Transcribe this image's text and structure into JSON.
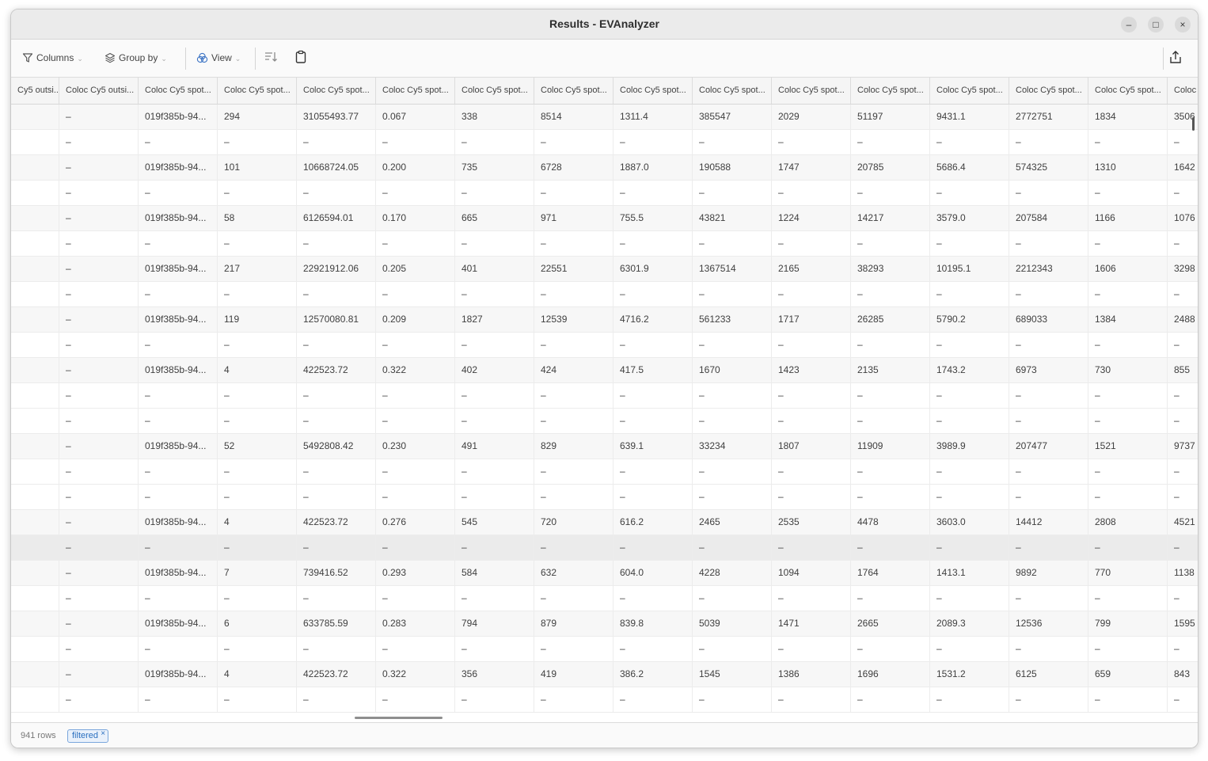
{
  "window": {
    "title": "Results - EVAnalyzer",
    "minimize_glyph": "–",
    "maximize_glyph": "□",
    "close_glyph": "×"
  },
  "toolbar": {
    "columns_label": "Columns",
    "group_by_label": "Group by",
    "view_label": "View",
    "columns_icon": "filter-icon",
    "group_by_icon": "layers-icon",
    "view_icon": "venn-icon",
    "sort_icon": "sort-icon",
    "clipboard_icon": "clipboard-icon",
    "export_icon": "share-icon"
  },
  "table": {
    "headers": [
      "Cy5 outsi...",
      "Coloc Cy5 outsi...",
      "Coloc Cy5 spot...",
      "Coloc Cy5 spot...",
      "Coloc Cy5 spot...",
      "Coloc Cy5 spot...",
      "Coloc Cy5 spot...",
      "Coloc Cy5 spot...",
      "Coloc Cy5 spot...",
      "Coloc Cy5 spot...",
      "Coloc Cy5 spot...",
      "Coloc Cy5 spot...",
      "Coloc Cy5 spot...",
      "Coloc Cy5 spot...",
      "Coloc Cy5 spot...",
      "Coloc"
    ],
    "rows": [
      [
        "",
        "–",
        "019f385b-94...",
        "294",
        "31055493.77",
        "0.067",
        "338",
        "8514",
        "1311.4",
        "385547",
        "2029",
        "51197",
        "9431.1",
        "2772751",
        "1834",
        "3506"
      ],
      [
        "",
        "–",
        "–",
        "–",
        "–",
        "–",
        "–",
        "–",
        "–",
        "–",
        "–",
        "–",
        "–",
        "–",
        "–",
        "–"
      ],
      [
        "",
        "–",
        "019f385b-94...",
        "101",
        "10668724.05",
        "0.200",
        "735",
        "6728",
        "1887.0",
        "190588",
        "1747",
        "20785",
        "5686.4",
        "574325",
        "1310",
        "1642"
      ],
      [
        "",
        "–",
        "–",
        "–",
        "–",
        "–",
        "–",
        "–",
        "–",
        "–",
        "–",
        "–",
        "–",
        "–",
        "–",
        "–"
      ],
      [
        "",
        "–",
        "019f385b-94...",
        "58",
        "6126594.01",
        "0.170",
        "665",
        "971",
        "755.5",
        "43821",
        "1224",
        "14217",
        "3579.0",
        "207584",
        "1166",
        "1076"
      ],
      [
        "",
        "–",
        "–",
        "–",
        "–",
        "–",
        "–",
        "–",
        "–",
        "–",
        "–",
        "–",
        "–",
        "–",
        "–",
        "–"
      ],
      [
        "",
        "–",
        "019f385b-94...",
        "217",
        "22921912.06",
        "0.205",
        "401",
        "22551",
        "6301.9",
        "1367514",
        "2165",
        "38293",
        "10195.1",
        "2212343",
        "1606",
        "3298"
      ],
      [
        "",
        "–",
        "–",
        "–",
        "–",
        "–",
        "–",
        "–",
        "–",
        "–",
        "–",
        "–",
        "–",
        "–",
        "–",
        "–"
      ],
      [
        "",
        "–",
        "019f385b-94...",
        "119",
        "12570080.81",
        "0.209",
        "1827",
        "12539",
        "4716.2",
        "561233",
        "1717",
        "26285",
        "5790.2",
        "689033",
        "1384",
        "2488"
      ],
      [
        "",
        "–",
        "–",
        "–",
        "–",
        "–",
        "–",
        "–",
        "–",
        "–",
        "–",
        "–",
        "–",
        "–",
        "–",
        "–"
      ],
      [
        "",
        "–",
        "019f385b-94...",
        "4",
        "422523.72",
        "0.322",
        "402",
        "424",
        "417.5",
        "1670",
        "1423",
        "2135",
        "1743.2",
        "6973",
        "730",
        "855"
      ],
      [
        "",
        "–",
        "–",
        "–",
        "–",
        "–",
        "–",
        "–",
        "–",
        "–",
        "–",
        "–",
        "–",
        "–",
        "–",
        "–"
      ],
      [
        "",
        "–",
        "–",
        "–",
        "–",
        "–",
        "–",
        "–",
        "–",
        "–",
        "–",
        "–",
        "–",
        "–",
        "–",
        "–"
      ],
      [
        "",
        "–",
        "019f385b-94...",
        "52",
        "5492808.42",
        "0.230",
        "491",
        "829",
        "639.1",
        "33234",
        "1807",
        "11909",
        "3989.9",
        "207477",
        "1521",
        "9737"
      ],
      [
        "",
        "–",
        "–",
        "–",
        "–",
        "–",
        "–",
        "–",
        "–",
        "–",
        "–",
        "–",
        "–",
        "–",
        "–",
        "–"
      ],
      [
        "",
        "–",
        "–",
        "–",
        "–",
        "–",
        "–",
        "–",
        "–",
        "–",
        "–",
        "–",
        "–",
        "–",
        "–",
        "–"
      ],
      [
        "",
        "–",
        "019f385b-94...",
        "4",
        "422523.72",
        "0.276",
        "545",
        "720",
        "616.2",
        "2465",
        "2535",
        "4478",
        "3603.0",
        "14412",
        "2808",
        "4521"
      ],
      [
        "",
        "–",
        "–",
        "–",
        "–",
        "–",
        "–",
        "–",
        "–",
        "–",
        "–",
        "–",
        "–",
        "–",
        "–",
        "–"
      ],
      [
        "",
        "–",
        "019f385b-94...",
        "7",
        "739416.52",
        "0.293",
        "584",
        "632",
        "604.0",
        "4228",
        "1094",
        "1764",
        "1413.1",
        "9892",
        "770",
        "1138"
      ],
      [
        "",
        "–",
        "–",
        "–",
        "–",
        "–",
        "–",
        "–",
        "–",
        "–",
        "–",
        "–",
        "–",
        "–",
        "–",
        "–"
      ],
      [
        "",
        "–",
        "019f385b-94...",
        "6",
        "633785.59",
        "0.283",
        "794",
        "879",
        "839.8",
        "5039",
        "1471",
        "2665",
        "2089.3",
        "12536",
        "799",
        "1595"
      ],
      [
        "",
        "–",
        "–",
        "–",
        "–",
        "–",
        "–",
        "–",
        "–",
        "–",
        "–",
        "–",
        "–",
        "–",
        "–",
        "–"
      ],
      [
        "",
        "–",
        "019f385b-94...",
        "4",
        "422523.72",
        "0.322",
        "356",
        "419",
        "386.2",
        "1545",
        "1386",
        "1696",
        "1531.2",
        "6125",
        "659",
        "843"
      ],
      [
        "",
        "–",
        "–",
        "–",
        "–",
        "–",
        "–",
        "–",
        "–",
        "–",
        "–",
        "–",
        "–",
        "–",
        "–",
        "–"
      ]
    ],
    "highlighted_row": 17
  },
  "status": {
    "row_count": "941 rows",
    "filter_badge": "filtered",
    "filter_badge_close": "×"
  },
  "colors": {
    "accent": "#2a6fbf",
    "header_bg": "#f5f5f5",
    "titlebar_bg": "#ebebeb"
  }
}
